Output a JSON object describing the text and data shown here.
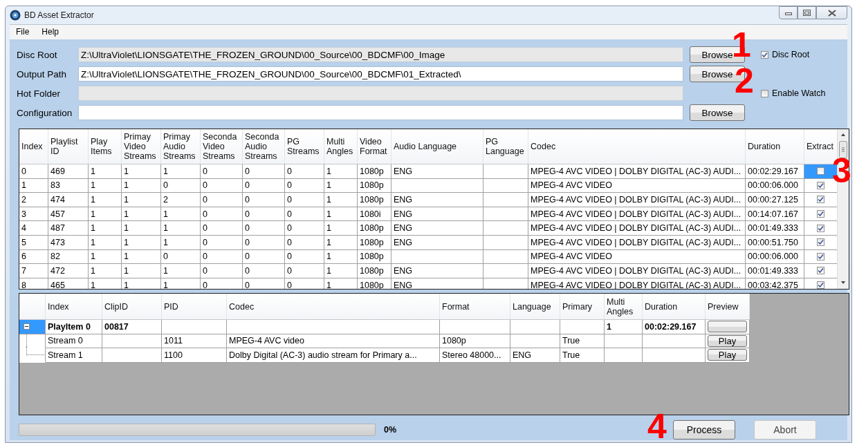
{
  "window": {
    "title": "BD Asset Extractor"
  },
  "menu": [
    "File",
    "Help"
  ],
  "fields": [
    {
      "label": "Disc Root",
      "value": "Z:\\UltraViolet\\LIONSGATE\\THE_FROZEN_GROUND\\00_Source\\00_BDCMF\\00_Image",
      "disabled": true,
      "button": "Browse",
      "option": {
        "label": "Disc Root",
        "checked": true
      }
    },
    {
      "label": "Output Path",
      "value": "Z:\\UltraViolet\\LIONSGATE\\THE_FROZEN_GROUND\\00_Source\\00_BDCMF\\01_Extracted\\",
      "disabled": false,
      "button": "Browse"
    },
    {
      "label": "Hot Folder",
      "disabled": true,
      "option": {
        "label": "Enable Watch",
        "checked": false
      }
    },
    {
      "label": "Configuration",
      "disabled": false,
      "button": "Browse"
    }
  ],
  "playlists": {
    "columns": [
      "Index",
      "Playlist ID",
      "Play Items",
      "Primay Video Streams",
      "Primay Audio Streams",
      "Seconda Video Streams",
      "Seconda Audio Streams",
      "PG Streams",
      "Multi Angles",
      "Video Format",
      "Audio Language",
      "PG Language",
      "Codec",
      "Duration",
      "Extract"
    ],
    "rows": [
      {
        "cells": [
          "0",
          "469",
          "1",
          "1",
          "1",
          "0",
          "0",
          "0",
          "1",
          "1080p",
          "ENG",
          null,
          "MPEG-4 AVC VIDEO | DOLBY DIGITAL (AC-3) AUDI...",
          "00:02:29.167"
        ],
        "extract": false,
        "selected": true
      },
      {
        "cells": [
          "1",
          "83",
          "1",
          "1",
          "0",
          "0",
          "0",
          "0",
          "1",
          "1080p",
          null,
          null,
          "MPEG-4 AVC VIDEO",
          "00:00:06.000"
        ],
        "extract": true,
        "selected": false
      },
      {
        "cells": [
          "2",
          "474",
          "1",
          "1",
          "2",
          "0",
          "0",
          "0",
          "1",
          "1080p",
          "ENG",
          null,
          "MPEG-4 AVC VIDEO | DOLBY DIGITAL (AC-3) AUDI...",
          "00:00:27.125"
        ],
        "extract": true,
        "selected": false
      },
      {
        "cells": [
          "3",
          "457",
          "1",
          "1",
          "1",
          "0",
          "0",
          "0",
          "1",
          "1080i",
          "ENG",
          null,
          "MPEG-4 AVC VIDEO | DOLBY DIGITAL (AC-3) AUDI...",
          "00:14:07.167"
        ],
        "extract": true,
        "selected": false
      },
      {
        "cells": [
          "4",
          "487",
          "1",
          "1",
          "1",
          "0",
          "0",
          "0",
          "1",
          "1080p",
          "ENG",
          null,
          "MPEG-4 AVC VIDEO | DOLBY DIGITAL (AC-3) AUDI...",
          "00:01:49.333"
        ],
        "extract": true,
        "selected": false
      },
      {
        "cells": [
          "5",
          "473",
          "1",
          "1",
          "1",
          "0",
          "0",
          "0",
          "1",
          "1080p",
          "ENG",
          null,
          "MPEG-4 AVC VIDEO | DOLBY DIGITAL (AC-3) AUDI...",
          "00:00:51.750"
        ],
        "extract": true,
        "selected": false
      },
      {
        "cells": [
          "6",
          "82",
          "1",
          "1",
          "0",
          "0",
          "0",
          "0",
          "1",
          "1080p",
          null,
          null,
          "MPEG-4 AVC VIDEO",
          "00:00:06.000"
        ],
        "extract": true,
        "selected": false
      },
      {
        "cells": [
          "7",
          "472",
          "1",
          "1",
          "1",
          "0",
          "0",
          "0",
          "1",
          "1080p",
          "ENG",
          null,
          "MPEG-4 AVC VIDEO | DOLBY DIGITAL (AC-3) AUDI...",
          "00:01:49.333"
        ],
        "extract": true,
        "selected": false
      },
      {
        "cells": [
          "8",
          "465",
          "1",
          "1",
          "1",
          "0",
          "0",
          "0",
          "1",
          "1080p",
          "ENG",
          null,
          "MPEG-4 AVC VIDEO | DOLBY DIGITAL (AC-3) AUDI...",
          "00:03:42.375"
        ],
        "extract": true,
        "selected": false
      }
    ]
  },
  "streams": {
    "columns": [
      "Index",
      "ClipID",
      "PID",
      "Codec",
      "Format",
      "Language",
      "Primary",
      "Multi Angles",
      "Duration",
      "Preview"
    ],
    "items": [
      {
        "cells": [
          "PlayItem 0",
          "00817",
          null,
          null,
          null,
          null,
          null,
          "1",
          "00:02:29.167"
        ],
        "expanded": true,
        "selected": true,
        "children": [
          {
            "cells": [
              "Stream 0",
              null,
              "1011",
              "MPEG-4 AVC video",
              "1080p",
              null,
              "True",
              null,
              null
            ],
            "preview": "Play"
          },
          {
            "cells": [
              "Stream 1",
              null,
              "1100",
              "Dolby Digital (AC-3) audio stream for Primary a...",
              "Stereo 48000...",
              "ENG",
              "True",
              null,
              null
            ],
            "preview": "Play"
          }
        ]
      }
    ]
  },
  "progress": {
    "level": 0,
    "label": "0%"
  },
  "buttons": [
    {
      "label": "Process",
      "disabled": false
    },
    {
      "label": "Abort",
      "disabled": true
    }
  ],
  "annotations": [
    "1",
    "2",
    "3",
    "4"
  ]
}
